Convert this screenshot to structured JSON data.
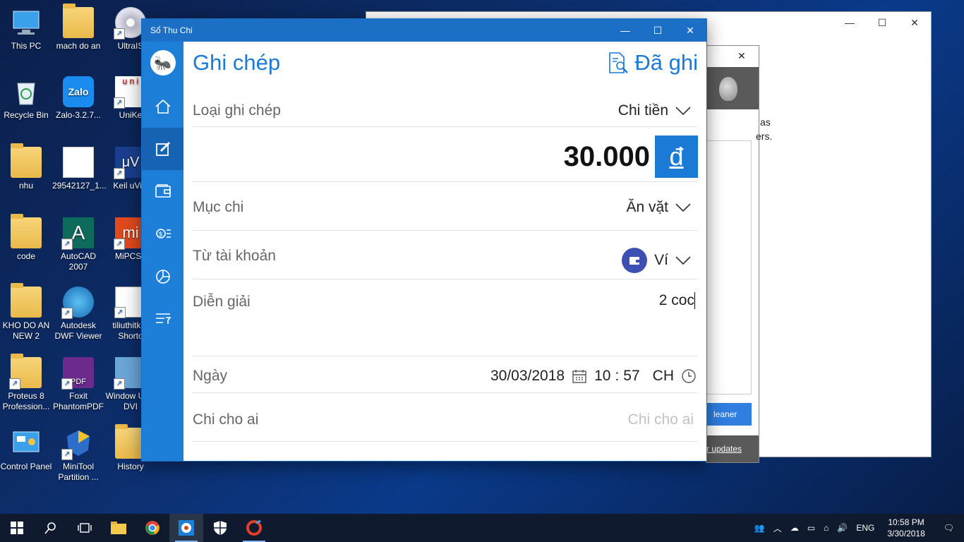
{
  "desktop": {
    "icons": [
      {
        "label": "This PC",
        "icon": "computer-icon"
      },
      {
        "label": "mach do an",
        "icon": "folder-icon"
      },
      {
        "label": "UltraIS",
        "icon": "disc-icon"
      },
      {
        "label": "Recycle Bin",
        "icon": "recycle-bin-icon"
      },
      {
        "label": "Zalo-3.2.7...",
        "icon": "zalo-icon"
      },
      {
        "label": "UniKe",
        "icon": "unikey-icon"
      },
      {
        "label": "nhu",
        "icon": "folder-icon"
      },
      {
        "label": "29542127_1...",
        "icon": "image-icon"
      },
      {
        "label": "Keil uVisi",
        "icon": "keil-icon"
      },
      {
        "label": "code",
        "icon": "file-icon"
      },
      {
        "label": "AutoCAD 2007",
        "icon": "autocad-icon"
      },
      {
        "label": "MiPCSu",
        "icon": "mi-icon"
      },
      {
        "label": "KHO DO AN NEW 2",
        "icon": "folder-icon"
      },
      {
        "label": "Autodesk DWF Viewer",
        "icon": "dwf-icon"
      },
      {
        "label": "tiliuthitkr - Shorto",
        "icon": "image-icon"
      },
      {
        "label": "Proteus 8 Profession...",
        "icon": "folder-icon"
      },
      {
        "label": "Foxit PhantomPDF",
        "icon": "pdf-icon"
      },
      {
        "label": "Window USB DVI",
        "icon": "usb-icon"
      },
      {
        "label": "Control Panel",
        "icon": "control-panel-icon"
      },
      {
        "label": "MiniTool Partition ...",
        "icon": "minitool-icon"
      },
      {
        "label": "History",
        "icon": "folder-icon"
      }
    ]
  },
  "background_windows": {
    "second": {
      "text_line1": "as",
      "text_line2": "ers.",
      "button_label": "leaner",
      "link_label": "r updates"
    }
  },
  "app": {
    "title": "Sổ Thu Chi",
    "page_title": "Ghi chép",
    "history_label": "Đã ghi",
    "sidebar": [
      "home-icon",
      "edit-icon",
      "wallet-icon",
      "money-icon",
      "chart-icon",
      "filter-icon"
    ],
    "type_label": "Loại ghi chép",
    "type_value": "Chi tiền",
    "amount": "30.000",
    "currency": "đ",
    "category_label": "Mục chi",
    "category_value": "Ăn vặt",
    "account_label": "Từ tài khoản",
    "account_value": "Ví",
    "description_label": "Diễn giải",
    "description_value": "2 coc",
    "date_label": "Ngày",
    "date_value": "30/03/2018",
    "time_hour": "10",
    "time_sep": ":",
    "time_minute": "57",
    "time_period": "CH",
    "payee_label": "Chi cho ai",
    "payee_placeholder": "Chi cho ai",
    "accent_color": "#1a7ad6"
  },
  "taskbar": {
    "language": "ENG",
    "time": "10:58 PM",
    "date": "3/30/2018"
  }
}
